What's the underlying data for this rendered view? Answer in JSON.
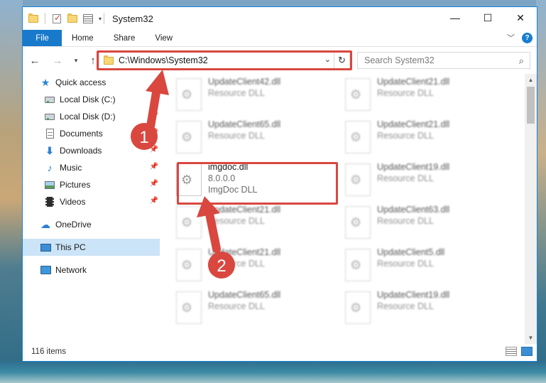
{
  "window": {
    "title": "System32",
    "controls": {
      "minimize": "—",
      "maximize": "☐",
      "close": "✕"
    }
  },
  "ribbon": {
    "tabs": [
      "File",
      "Home",
      "Share",
      "View"
    ],
    "help": "?"
  },
  "address": {
    "path": "C:\\Windows\\System32",
    "search_placeholder": "Search System32"
  },
  "sidebar": {
    "items": [
      {
        "label": "Quick access",
        "icon": "star-icon"
      },
      {
        "label": "Local Disk (C:)",
        "icon": "drive-icon"
      },
      {
        "label": "Local Disk (D:)",
        "icon": "drive-icon",
        "pinned": true
      },
      {
        "label": "Documents",
        "icon": "document-icon",
        "pinned": true
      },
      {
        "label": "Downloads",
        "icon": "download-icon",
        "pinned": true
      },
      {
        "label": "Music",
        "icon": "music-icon",
        "pinned": true
      },
      {
        "label": "Pictures",
        "icon": "pictures-icon",
        "pinned": true
      },
      {
        "label": "Videos",
        "icon": "videos-icon",
        "pinned": true
      },
      {
        "label": "OneDrive",
        "icon": "cloud-icon"
      },
      {
        "label": "This PC",
        "icon": "computer-icon",
        "selected": true
      },
      {
        "label": "Network",
        "icon": "network-icon"
      }
    ]
  },
  "files": [
    {
      "name": "UpdateClient42.dll",
      "type": "Resource DLL"
    },
    {
      "name": "UpdateClient21.dll",
      "type": "Resource DLL"
    },
    {
      "name": "UpdateClient65.dll",
      "type": "Resource DLL"
    },
    {
      "name": "UpdateClient21.dll",
      "type": "Resource DLL"
    },
    {
      "name": "imgdoc.dll",
      "version": "8.0.0.0",
      "type": "ImgDoc DLL"
    },
    {
      "name": "UpdateClient19.dll",
      "type": "Resource DLL"
    },
    {
      "name": "UpdateClient21.dll",
      "type": "Resource DLL"
    },
    {
      "name": "UpdateClient63.dll",
      "type": "Resource DLL"
    },
    {
      "name": "UpdateClient21.dll",
      "type": "Resource DLL"
    },
    {
      "name": "UpdateClient5.dll",
      "type": "Resource DLL"
    },
    {
      "name": "UpdateClient65.dll",
      "type": "Resource DLL"
    },
    {
      "name": "UpdateClient19.dll",
      "type": "Resource DLL"
    }
  ],
  "status": {
    "item_count": "116 items"
  },
  "annotations": {
    "step1": "1",
    "step2": "2",
    "color": "#d9473f"
  }
}
